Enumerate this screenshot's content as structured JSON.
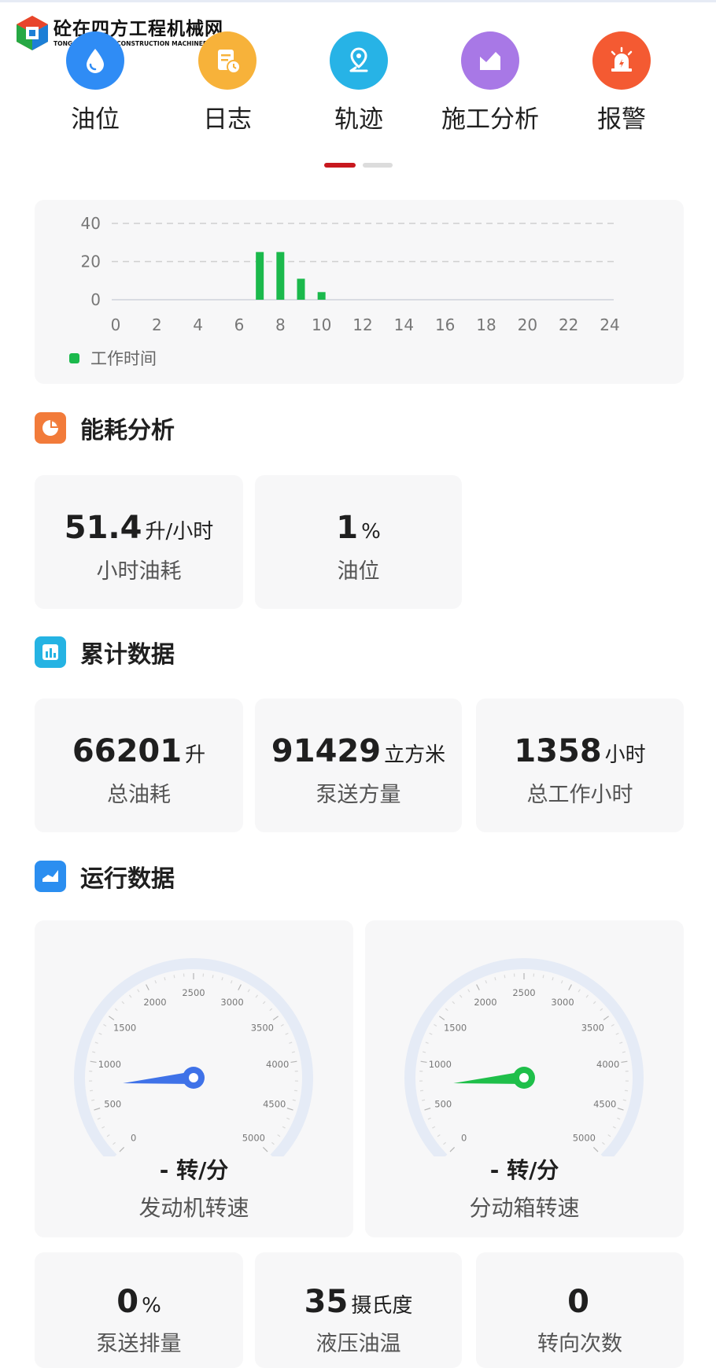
{
  "brand": {
    "name_cn": "砼在四方工程机械网",
    "name_en": "TONG ZAI SI FANG CONSTRUCTION MACHINERY NETWORK"
  },
  "nav": [
    {
      "label": "油位",
      "icon": "droplet-icon",
      "color": "#2f8cf5"
    },
    {
      "label": "日志",
      "icon": "log-clock-icon",
      "color": "#f7b23a"
    },
    {
      "label": "轨迹",
      "icon": "location-pin-icon",
      "color": "#27b3e6"
    },
    {
      "label": "施工分析",
      "icon": "analysis-chart-icon",
      "color": "#a878e6"
    },
    {
      "label": "报警",
      "icon": "alarm-siren-icon",
      "color": "#f45a32"
    }
  ],
  "pager": {
    "active_color": "#c8181e",
    "inactive_color": "#dcdcdc"
  },
  "chart_data": {
    "type": "bar",
    "x": [
      7,
      8,
      9,
      10
    ],
    "values": [
      25,
      25,
      11,
      4
    ],
    "xlim": [
      0,
      24
    ],
    "xticks": [
      "0",
      "2",
      "4",
      "6",
      "8",
      "10",
      "12",
      "14",
      "16",
      "18",
      "20",
      "22",
      "24"
    ],
    "ylim": [
      0,
      40
    ],
    "yticks": [
      "0",
      "20",
      "40"
    ],
    "grid": true,
    "legend": "工作时间",
    "legend_position": "bottom-left",
    "color": "#1bb94c"
  },
  "energy": {
    "title": "能耗分析",
    "icon": "pie-chart-icon",
    "items": [
      {
        "value": "51.4",
        "unit": "升/小时",
        "label": "小时油耗"
      },
      {
        "value": "1",
        "unit": "%",
        "label": "油位"
      }
    ]
  },
  "cumulative": {
    "title": "累计数据",
    "icon": "bar-chart-icon",
    "items": [
      {
        "value": "66201",
        "unit": "升",
        "label": "总油耗"
      },
      {
        "value": "91429",
        "unit": "立方米",
        "label": "泵送方量"
      },
      {
        "value": "1358",
        "unit": "小时",
        "label": "总工作小时"
      }
    ]
  },
  "running": {
    "title": "运行数据",
    "icon": "area-chart-icon",
    "gauges": [
      {
        "value": "-",
        "unit": "转/分",
        "label": "发动机转速",
        "color": "#3f72e8",
        "needle_value": 750
      },
      {
        "value": "-",
        "unit": "转/分",
        "label": "分动箱转速",
        "color": "#1fbf4a",
        "needle_value": 750
      }
    ],
    "gauge_ticks": [
      "0",
      "500",
      "1000",
      "1500",
      "2000",
      "2500",
      "3000",
      "3500",
      "4000",
      "4500",
      "5000"
    ],
    "items": [
      {
        "value": "0",
        "unit": "%",
        "label": "泵送排量"
      },
      {
        "value": "35",
        "unit": "摄氏度",
        "label": "液压油温"
      },
      {
        "value": "0",
        "unit": "",
        "label": "转向次数"
      }
    ]
  }
}
